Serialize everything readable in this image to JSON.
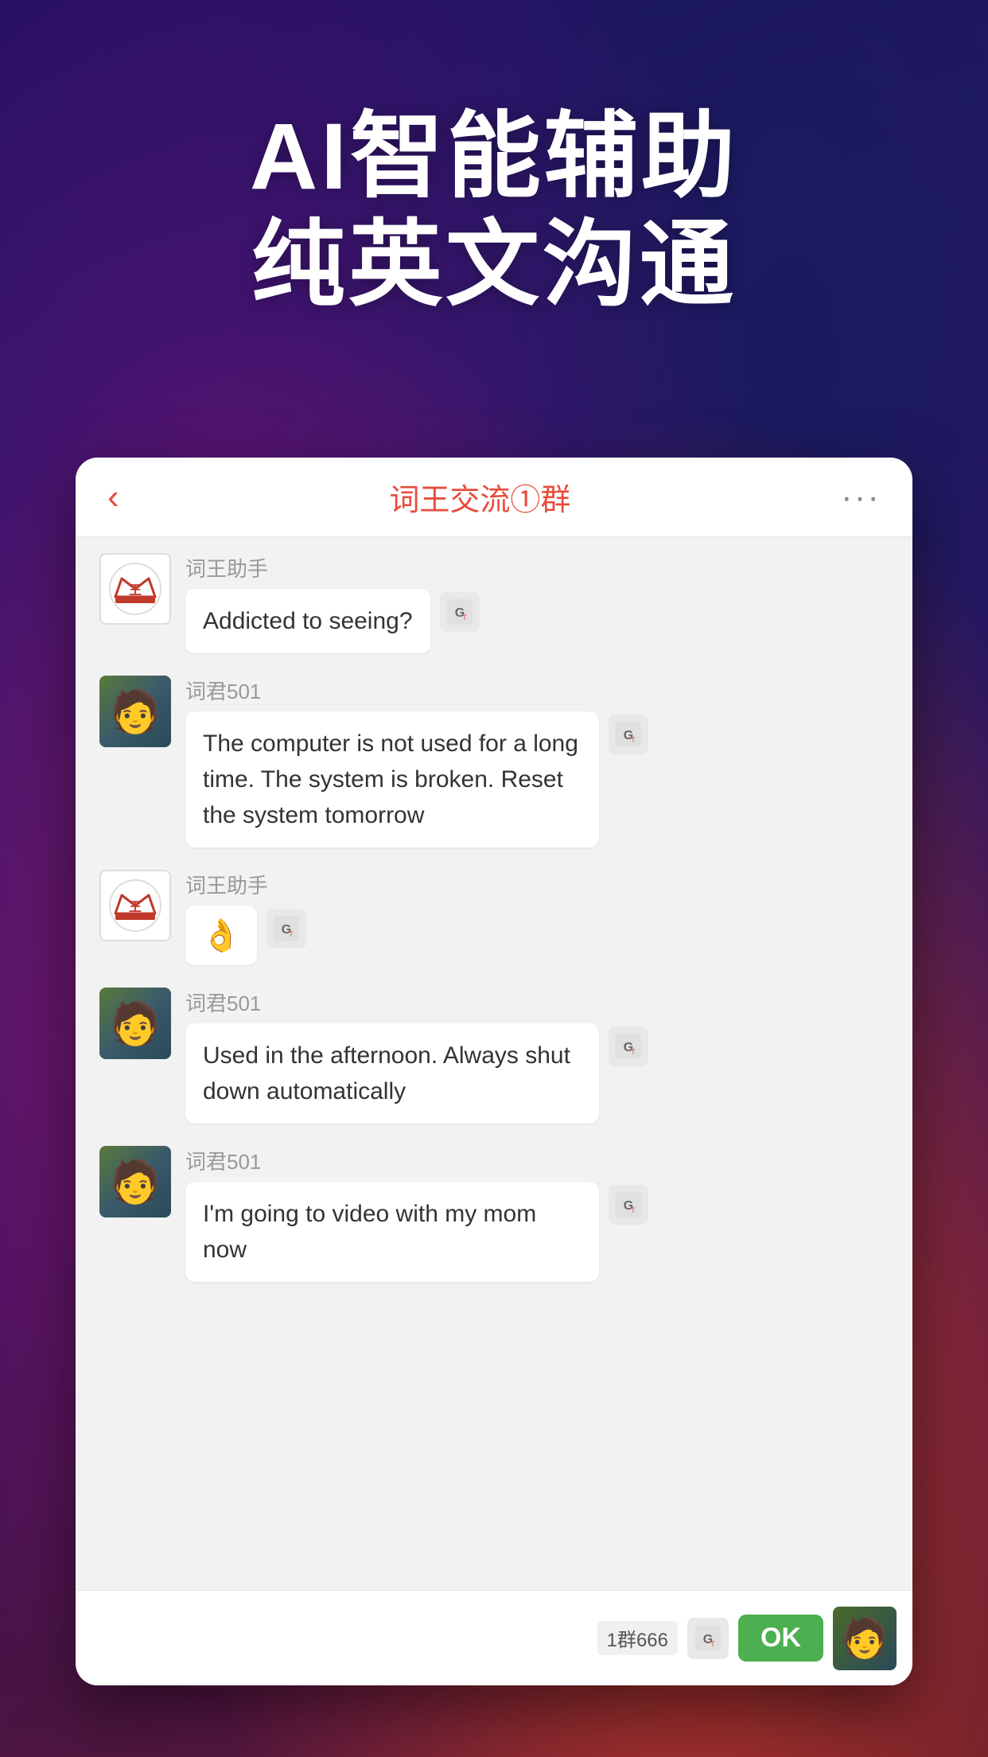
{
  "background": {
    "description": "dark gradient background with purple, blue, red tones"
  },
  "hero": {
    "title_line1": "AI智能辅助",
    "title_line2": "纯英文沟通"
  },
  "chat": {
    "header": {
      "back_label": "‹",
      "title": "词王交流①群",
      "more_label": "···"
    },
    "messages": [
      {
        "id": 1,
        "sender": "词王助手",
        "sender_type": "bot",
        "content": "Addicted to seeing?",
        "emoji": null,
        "has_translate": true
      },
      {
        "id": 2,
        "sender": "词君501",
        "sender_type": "user",
        "content": "The computer is not used for a long time. The system is broken. Reset the system tomorrow",
        "emoji": null,
        "has_translate": true
      },
      {
        "id": 3,
        "sender": "词王助手",
        "sender_type": "bot",
        "content": null,
        "emoji": "👌",
        "has_translate": true
      },
      {
        "id": 4,
        "sender": "词君501",
        "sender_type": "user",
        "content": "Used in the afternoon. Always shut down automatically",
        "emoji": null,
        "has_translate": true
      },
      {
        "id": 5,
        "sender": "词君501",
        "sender_type": "user",
        "content": "I'm going to video with my mom now",
        "emoji": null,
        "has_translate": true
      }
    ],
    "bottom_bar": {
      "group_label": "1群666",
      "ok_button": "OK"
    }
  }
}
